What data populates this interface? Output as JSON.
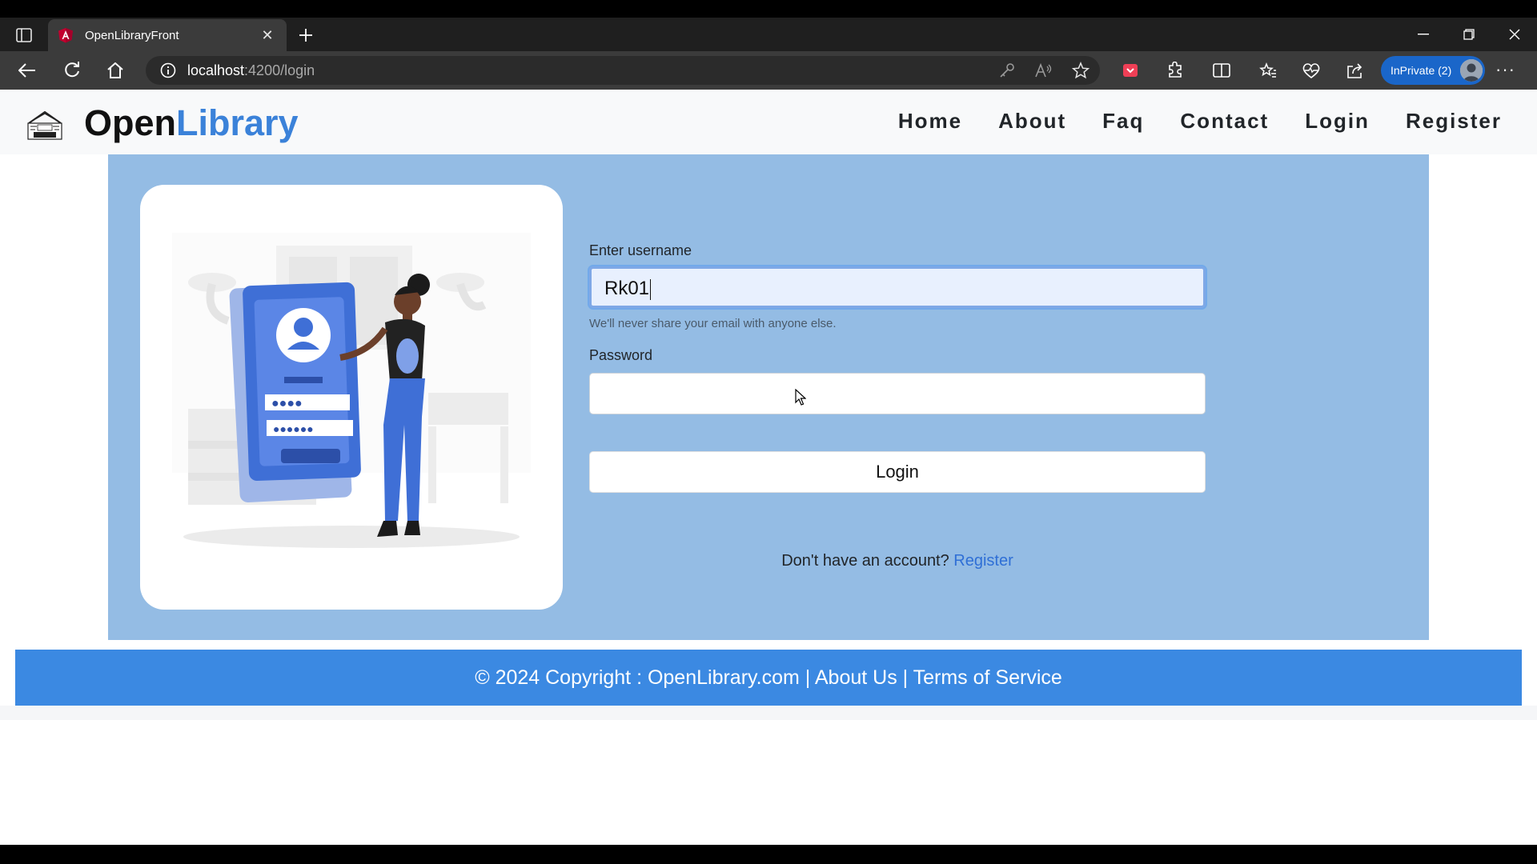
{
  "browser": {
    "tab_title": "OpenLibraryFront",
    "url_host": "localhost",
    "url_path": ":4200/login",
    "inprivate_label": "InPrivate (2)"
  },
  "navbar": {
    "brand_open": "Open",
    "brand_library": "Library",
    "links": [
      "Home",
      "About",
      "Faq",
      "Contact",
      "Login",
      "Register"
    ]
  },
  "form": {
    "username_label": "Enter username",
    "username_value": "Rk01",
    "username_help": "We'll never share your email with anyone else.",
    "password_label": "Password",
    "password_value": "",
    "login_button": "Login",
    "signup_text": "Don't have an account? ",
    "signup_link": "Register"
  },
  "footer": {
    "text": "© 2024 Copyright : OpenLibrary.com | About Us | Terms of Service"
  },
  "colors": {
    "brand_blue": "#3b82d9",
    "section_bg": "#94bce4",
    "footer_bg": "#3b89e2",
    "link_blue": "#2f6fd6"
  },
  "icons": [
    "tab-actions-icon",
    "angular-favicon",
    "close-icon",
    "plus-icon",
    "minimize-icon",
    "restore-icon",
    "window-close-icon",
    "back-icon",
    "refresh-icon",
    "home-icon",
    "info-icon",
    "key-icon",
    "read-aloud-icon",
    "star-icon",
    "pocket-icon",
    "extensions-icon",
    "split-screen-icon",
    "favorites-icon",
    "performance-icon",
    "share-icon",
    "more-icon",
    "mouse-cursor-icon"
  ]
}
